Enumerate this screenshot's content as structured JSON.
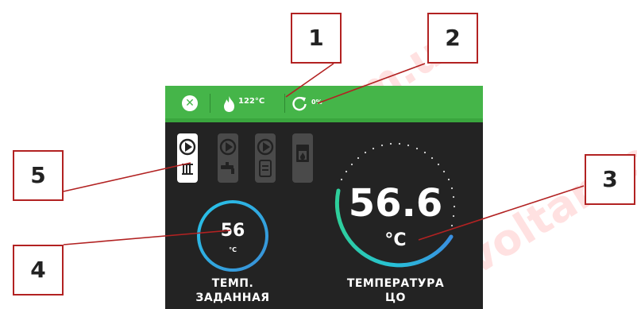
{
  "status_bar": {
    "close_icon": "close-icon",
    "flame_icon": "flame-icon",
    "boiler_temp": "122°C",
    "refresh_icon": "refresh-icon",
    "percent": "0%",
    "colors": {
      "bar": "#45b549",
      "screen": "#232323"
    }
  },
  "modes": [
    {
      "name": "pump-radiator-icon",
      "active": true
    },
    {
      "name": "pump-tap-icon",
      "active": false
    },
    {
      "name": "pump-tank-icon",
      "active": false
    },
    {
      "name": "fireplace-icon",
      "active": false
    }
  ],
  "set_temp": {
    "value": "56",
    "unit": "°C",
    "label_line1": "ТЕМП.",
    "label_line2": "ЗАДАННАЯ"
  },
  "co_temp": {
    "value": "56.6",
    "unit": "°C",
    "label_line1": "ТЕМПЕРАТУРА",
    "label_line2": "ЦО"
  },
  "callouts": {
    "c1": "1",
    "c2": "2",
    "c3": "3",
    "c4": "4",
    "c5": "5"
  },
  "watermark": "voltar.com.ua"
}
